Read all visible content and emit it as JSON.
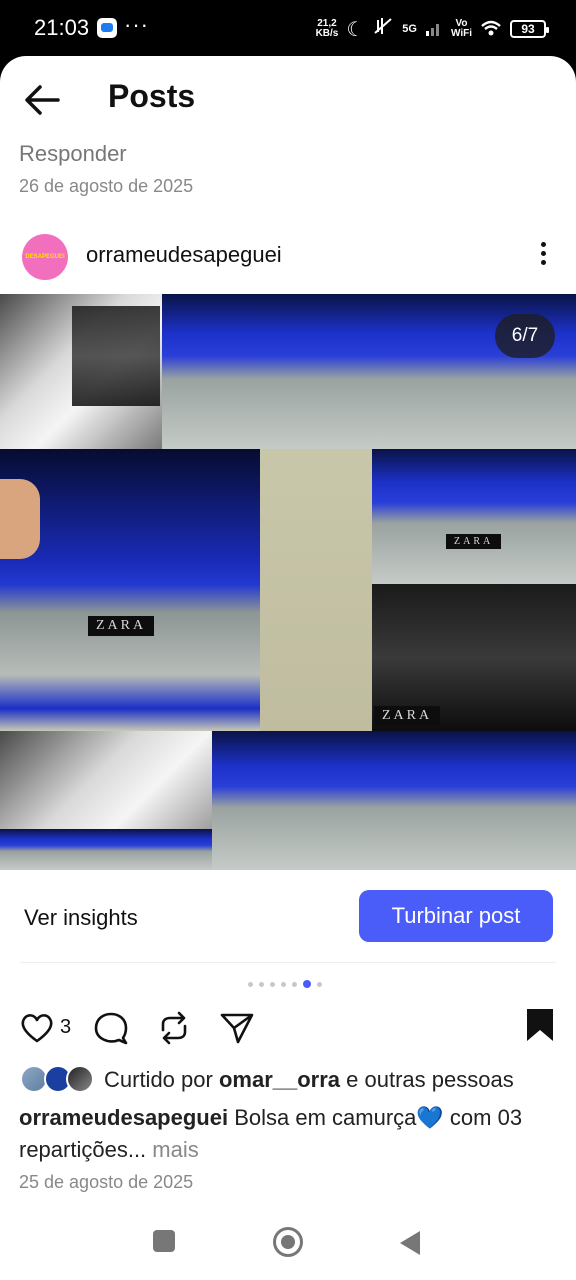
{
  "status_bar": {
    "time": "21:03",
    "more": "···",
    "net_speed_value": "21,2",
    "net_speed_unit": "KB/s",
    "network": "5G",
    "volte": "Vo",
    "wifi_label": "WiFi",
    "battery": "93"
  },
  "header": {
    "title": "Posts"
  },
  "reply": {
    "label": "Responder",
    "date": "26 de agosto de 2025"
  },
  "post": {
    "username": "orrameudesapeguei",
    "avatar_text": "DESAPEGUEI",
    "counter": "6/7",
    "brand_label": "ZARA",
    "insights_label": "Ver insights",
    "boost_label": "Turbinar post",
    "carousel_total": 7,
    "carousel_active": 6,
    "like_count": "3",
    "liked_by_prefix": "Curtido por ",
    "liked_by_user": "omar__orra",
    "liked_by_suffix": " e outras pessoas",
    "caption_user": "orrameudesapeguei",
    "caption_text": "Bolsa em camurça",
    "caption_emoji": "💙",
    "caption_text2": " com 03 repartições...",
    "caption_more": " mais",
    "date": "25 de agosto de 2025"
  },
  "colors": {
    "accent": "#4a5df9",
    "avatar_bg": "#f26fbd",
    "velvet_blue": "#2a3fd8"
  },
  "icons": [
    "back-arrow-icon",
    "more-vertical-icon",
    "heart-icon",
    "comment-icon",
    "repost-icon",
    "share-icon",
    "bookmark-icon"
  ]
}
